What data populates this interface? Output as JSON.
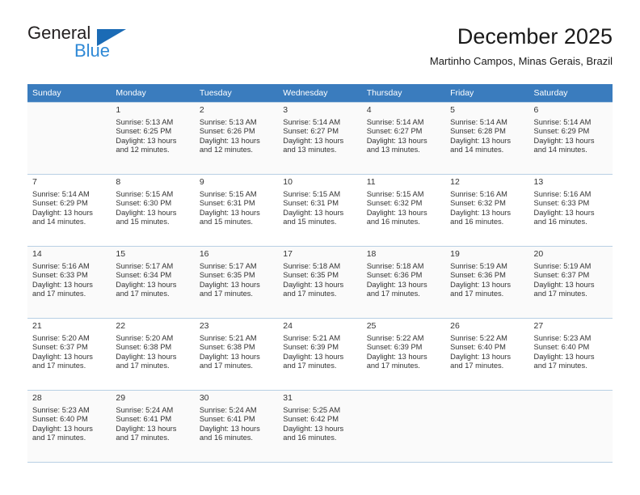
{
  "brand": {
    "name_part1": "General",
    "name_part2": "Blue",
    "triangle_color": "#1b6bb5",
    "blue_color": "#2f89d6"
  },
  "header": {
    "title": "December 2025",
    "subtitle": "Martinho Campos, Minas Gerais, Brazil"
  },
  "theme": {
    "header_bg": "#3a7cbe",
    "header_text": "#ffffff",
    "grid_line": "#b8cfe4",
    "row_shade": "#fafafa"
  },
  "calendar": {
    "weekday_headers": [
      "Sunday",
      "Monday",
      "Tuesday",
      "Wednesday",
      "Thursday",
      "Friday",
      "Saturday"
    ],
    "weeks": [
      [
        {
          "day": "",
          "info": ""
        },
        {
          "day": "1",
          "info": "Sunrise: 5:13 AM\nSunset: 6:25 PM\nDaylight: 13 hours\nand 12 minutes."
        },
        {
          "day": "2",
          "info": "Sunrise: 5:13 AM\nSunset: 6:26 PM\nDaylight: 13 hours\nand 12 minutes."
        },
        {
          "day": "3",
          "info": "Sunrise: 5:14 AM\nSunset: 6:27 PM\nDaylight: 13 hours\nand 13 minutes."
        },
        {
          "day": "4",
          "info": "Sunrise: 5:14 AM\nSunset: 6:27 PM\nDaylight: 13 hours\nand 13 minutes."
        },
        {
          "day": "5",
          "info": "Sunrise: 5:14 AM\nSunset: 6:28 PM\nDaylight: 13 hours\nand 14 minutes."
        },
        {
          "day": "6",
          "info": "Sunrise: 5:14 AM\nSunset: 6:29 PM\nDaylight: 13 hours\nand 14 minutes."
        }
      ],
      [
        {
          "day": "7",
          "info": "Sunrise: 5:14 AM\nSunset: 6:29 PM\nDaylight: 13 hours\nand 14 minutes."
        },
        {
          "day": "8",
          "info": "Sunrise: 5:15 AM\nSunset: 6:30 PM\nDaylight: 13 hours\nand 15 minutes."
        },
        {
          "day": "9",
          "info": "Sunrise: 5:15 AM\nSunset: 6:31 PM\nDaylight: 13 hours\nand 15 minutes."
        },
        {
          "day": "10",
          "info": "Sunrise: 5:15 AM\nSunset: 6:31 PM\nDaylight: 13 hours\nand 15 minutes."
        },
        {
          "day": "11",
          "info": "Sunrise: 5:15 AM\nSunset: 6:32 PM\nDaylight: 13 hours\nand 16 minutes."
        },
        {
          "day": "12",
          "info": "Sunrise: 5:16 AM\nSunset: 6:32 PM\nDaylight: 13 hours\nand 16 minutes."
        },
        {
          "day": "13",
          "info": "Sunrise: 5:16 AM\nSunset: 6:33 PM\nDaylight: 13 hours\nand 16 minutes."
        }
      ],
      [
        {
          "day": "14",
          "info": "Sunrise: 5:16 AM\nSunset: 6:33 PM\nDaylight: 13 hours\nand 17 minutes."
        },
        {
          "day": "15",
          "info": "Sunrise: 5:17 AM\nSunset: 6:34 PM\nDaylight: 13 hours\nand 17 minutes."
        },
        {
          "day": "16",
          "info": "Sunrise: 5:17 AM\nSunset: 6:35 PM\nDaylight: 13 hours\nand 17 minutes."
        },
        {
          "day": "17",
          "info": "Sunrise: 5:18 AM\nSunset: 6:35 PM\nDaylight: 13 hours\nand 17 minutes."
        },
        {
          "day": "18",
          "info": "Sunrise: 5:18 AM\nSunset: 6:36 PM\nDaylight: 13 hours\nand 17 minutes."
        },
        {
          "day": "19",
          "info": "Sunrise: 5:19 AM\nSunset: 6:36 PM\nDaylight: 13 hours\nand 17 minutes."
        },
        {
          "day": "20",
          "info": "Sunrise: 5:19 AM\nSunset: 6:37 PM\nDaylight: 13 hours\nand 17 minutes."
        }
      ],
      [
        {
          "day": "21",
          "info": "Sunrise: 5:20 AM\nSunset: 6:37 PM\nDaylight: 13 hours\nand 17 minutes."
        },
        {
          "day": "22",
          "info": "Sunrise: 5:20 AM\nSunset: 6:38 PM\nDaylight: 13 hours\nand 17 minutes."
        },
        {
          "day": "23",
          "info": "Sunrise: 5:21 AM\nSunset: 6:38 PM\nDaylight: 13 hours\nand 17 minutes."
        },
        {
          "day": "24",
          "info": "Sunrise: 5:21 AM\nSunset: 6:39 PM\nDaylight: 13 hours\nand 17 minutes."
        },
        {
          "day": "25",
          "info": "Sunrise: 5:22 AM\nSunset: 6:39 PM\nDaylight: 13 hours\nand 17 minutes."
        },
        {
          "day": "26",
          "info": "Sunrise: 5:22 AM\nSunset: 6:40 PM\nDaylight: 13 hours\nand 17 minutes."
        },
        {
          "day": "27",
          "info": "Sunrise: 5:23 AM\nSunset: 6:40 PM\nDaylight: 13 hours\nand 17 minutes."
        }
      ],
      [
        {
          "day": "28",
          "info": "Sunrise: 5:23 AM\nSunset: 6:40 PM\nDaylight: 13 hours\nand 17 minutes."
        },
        {
          "day": "29",
          "info": "Sunrise: 5:24 AM\nSunset: 6:41 PM\nDaylight: 13 hours\nand 17 minutes."
        },
        {
          "day": "30",
          "info": "Sunrise: 5:24 AM\nSunset: 6:41 PM\nDaylight: 13 hours\nand 16 minutes."
        },
        {
          "day": "31",
          "info": "Sunrise: 5:25 AM\nSunset: 6:42 PM\nDaylight: 13 hours\nand 16 minutes."
        },
        {
          "day": "",
          "info": ""
        },
        {
          "day": "",
          "info": ""
        },
        {
          "day": "",
          "info": ""
        }
      ]
    ]
  }
}
